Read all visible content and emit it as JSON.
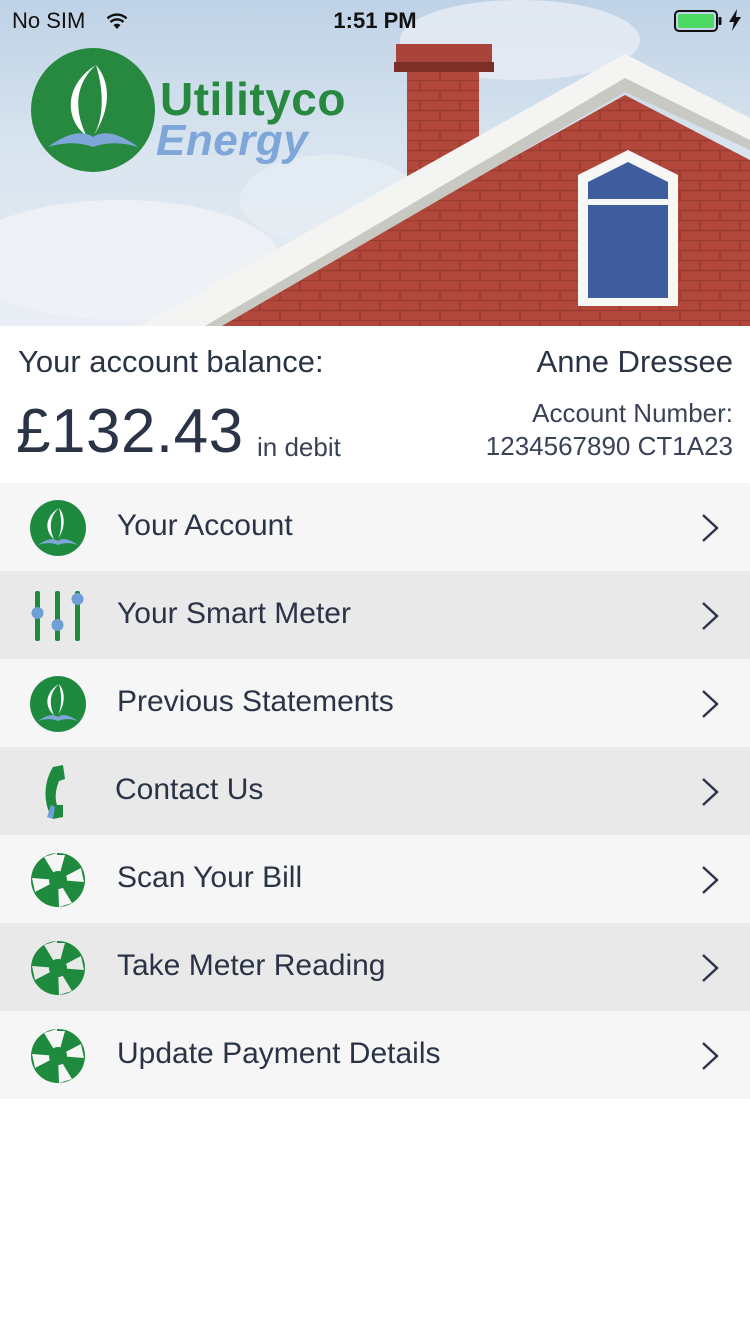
{
  "status_bar": {
    "carrier": "No SIM",
    "time": "1:51 PM",
    "battery_icon": "battery-full-icon",
    "battery_level": 1.0
  },
  "brand": {
    "line1": "Utilityco",
    "line2": "Energy",
    "green": "#27893f",
    "blue": "#7fa6d9"
  },
  "account": {
    "balance_label": "Your account balance:",
    "name": "Anne Dressee",
    "balance_amount": "£132.43",
    "balance_status": "in debit",
    "number_label": "Account Number:",
    "number_value": "1234567890 CT1A23"
  },
  "menu": [
    {
      "label": "Your Account",
      "icon": "flame-logo-icon"
    },
    {
      "label": "Your Smart Meter",
      "icon": "sliders-icon"
    },
    {
      "label": "Previous Statements",
      "icon": "flame-logo-icon"
    },
    {
      "label": "Contact Us",
      "icon": "phone-icon"
    },
    {
      "label": "Scan Your Bill",
      "icon": "camera-shutter-icon"
    },
    {
      "label": "Take Meter Reading",
      "icon": "camera-shutter-icon"
    },
    {
      "label": "Update Payment Details",
      "icon": "camera-shutter-icon"
    }
  ]
}
